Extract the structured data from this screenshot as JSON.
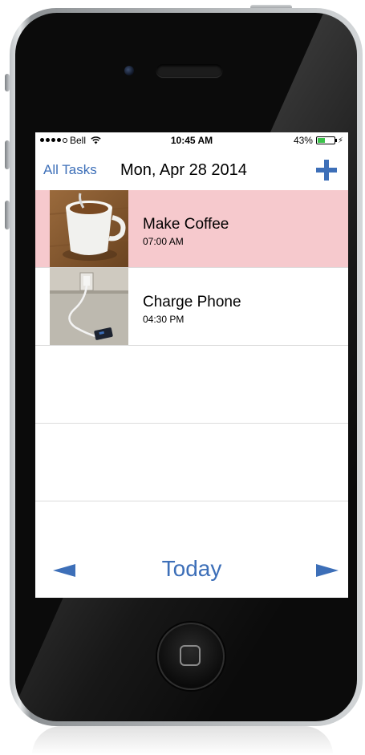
{
  "status_bar": {
    "carrier": "Bell",
    "signal_dots_filled": 4,
    "signal_dots_total": 5,
    "time": "10:45 AM",
    "battery_percent": "43%",
    "battery_level": 0.43,
    "battery_color": "#3bc24a"
  },
  "nav": {
    "back_label": "All Tasks",
    "title": "Mon, Apr 28 2014",
    "add_icon": "plus-icon",
    "accent_color": "#3d6fb8"
  },
  "tasks": [
    {
      "name": "Make Coffee",
      "time": "07:00 AM",
      "highlighted": true,
      "image": "coffee-mug-photo"
    },
    {
      "name": "Charge Phone",
      "time": "04:30 PM",
      "highlighted": false,
      "image": "phone-charger-photo"
    }
  ],
  "footer": {
    "prev_icon": "left-arrow-icon",
    "today_label": "Today",
    "next_icon": "right-arrow-icon"
  },
  "colors": {
    "highlight_row": "#f6c9cd",
    "accent": "#3d6fb8"
  }
}
